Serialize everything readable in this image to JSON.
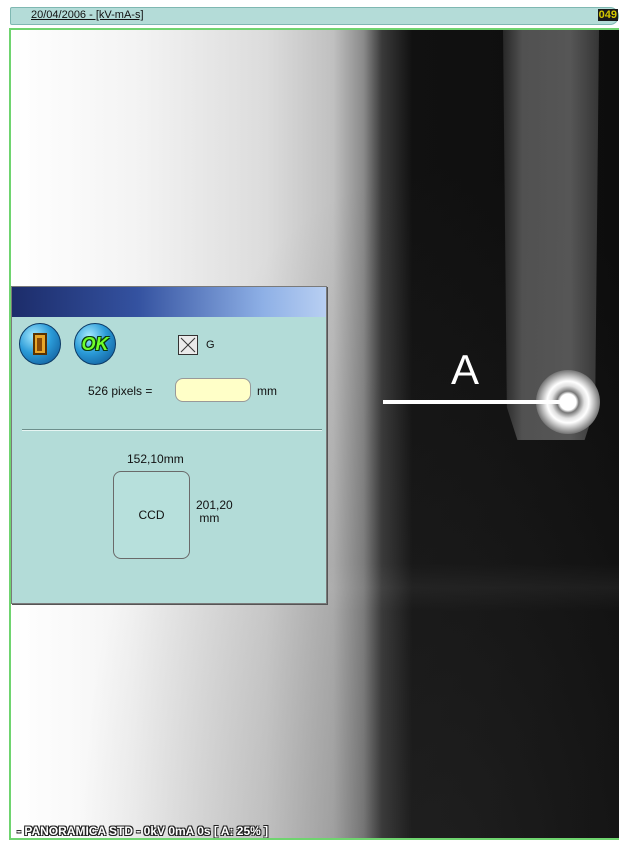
{
  "header": {
    "date_info": "20/04/2006 - [kV-mA-s]",
    "right_number": "049"
  },
  "image": {
    "marker_label": "A",
    "status_text": "- PANORAMICA STD - 0kV 0mA 0s  [ A: 25% ]"
  },
  "calibration_dialog": {
    "checkbox_label": "G",
    "pixels_label": "526 pixels =",
    "mm_input_value": "",
    "mm_unit": "mm",
    "sensor_width": "152,10mm",
    "sensor_label": "CCD",
    "sensor_height_value": "201,20",
    "sensor_height_unit": "mm",
    "icons": [
      "door-exit-icon",
      "ok-icon",
      "checkbox-cross-icon"
    ]
  },
  "colors": {
    "dialog_bg": "#b3dcd8",
    "input_bg": "#ffffc8",
    "viewer_border": "#6fd46f",
    "title_gradient_start": "#1c2c6a"
  }
}
